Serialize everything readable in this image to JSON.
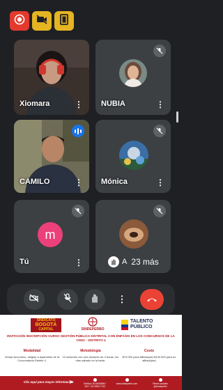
{
  "toolbar": {
    "record_icon": "record-icon",
    "camera_off_icon": "camera-off-icon",
    "exit_icon": "exit-icon",
    "accent_red": "#e23b2e",
    "accent_yellow": "#e4b423"
  },
  "participants": [
    {
      "name": "Xiomara",
      "muted": false,
      "type": "video"
    },
    {
      "name": "NUBIA",
      "muted": true,
      "type": "photo"
    },
    {
      "name": "CAMILO",
      "muted": false,
      "type": "video",
      "speaking": true
    },
    {
      "name": "Mónica",
      "muted": true,
      "type": "photo"
    },
    {
      "name": "Tú",
      "muted": true,
      "type": "initial",
      "initial": "m",
      "avatar_color": "#ec407a"
    },
    {
      "name": "A",
      "muted": true,
      "type": "photo"
    }
  ],
  "more_label": "⋮",
  "more_participants_label": "23 más",
  "controls": {
    "camera_icon": "camera-off-icon",
    "mic_icon": "mic-off-icon",
    "hand_icon": "raise-hand-icon",
    "more_icon": "more-vert-icon",
    "end_icon": "end-call-icon",
    "end_color": "#ea4335"
  },
  "ad": {
    "logo_left_line1": "SINDICATO",
    "logo_left_line2": "BOGOTÁ",
    "logo_left_line3": "CAPITAL",
    "logo_mid": "SINDEPERBO",
    "logo_right_line1": "TALENTO",
    "logo_right_line2": "PÚBLICO",
    "title": "INVITACIÓN INSCRIPCIÓN CURSO GESTIÓN PÚBLICA DISTRITAL CON ÉNFASIS EN LOS CONCURSOS DE LA CNSC - DISTRITO 4",
    "columns": [
      {
        "heading": "Modalidad",
        "text": "Virtual sincrónico, dirigido a aspirantes de la Convocatoria Distrito 4."
      },
      {
        "heading": "Metodología",
        "text": "12 sesiones con una duración de 4 horas, los días sábado en la tarde."
      },
      {
        "heading": "Costo",
        "text": "$70.000 para afiliado(as) $140.000 para no afiliado(as)"
      }
    ],
    "cta": "Clic aquí para mayor información",
    "contacts": [
      "Teléfono 3015445566 / 3017 741 5984 7703",
      "www.sindeperbo.com",
      "Redes sociales @sindeperbo"
    ],
    "brand_color": "#b01b22"
  }
}
